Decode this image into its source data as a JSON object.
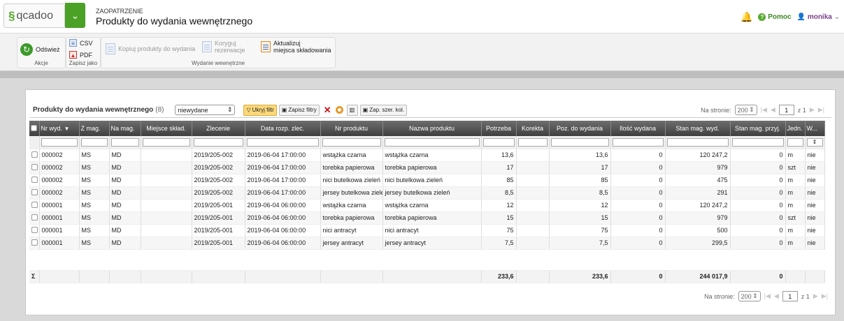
{
  "app": {
    "logo_text": "qcadoo",
    "logo_icon": "qcadoo-swirl-icon"
  },
  "header": {
    "breadcrumb": "ZAOPATRZENIE",
    "title": "Produkty do wydania wewnętrznego",
    "help_label": "Pomoc",
    "user_name": "monika"
  },
  "ribbon": {
    "groups": [
      {
        "label": "Akcje"
      },
      {
        "label": "Zapisz jako"
      },
      {
        "label": "Wydanie wewnętrzne"
      }
    ],
    "refresh_label": "Odśwież",
    "csv_label": "CSV",
    "pdf_label": "PDF",
    "copy_label": "Kopiuj produkty do wydania",
    "correct_label_1": "Koryguj",
    "correct_label_2": "rezerwacje",
    "update_label_1": "Aktualizuj",
    "update_label_2": "miejsca składowania"
  },
  "grid": {
    "title": "Produkty do wydania wewnętrznego",
    "count": "(8)",
    "filter_select": "niewydane",
    "hide_filter": "Ukryj filtr",
    "save_filters": "Zapisz filtry",
    "save_widths": "Zap. szer. kol.",
    "per_page_label": "Na stronie:",
    "per_page_value": "200",
    "page_value": "1",
    "page_of": "z 1",
    "columns": [
      "Nr wyd.",
      "Z mag.",
      "Na mag.",
      "Miejsce skład.",
      "Zlecenie",
      "Data rozp. zlec.",
      "Nr produktu",
      "Nazwa produktu",
      "Potrzeba",
      "Korekta",
      "Poz. do wydania",
      "Ilość wydana",
      "Stan mag. wyd.",
      "Stan mag. przyj.",
      "Jedn.",
      "W..."
    ],
    "rows": [
      [
        "000002",
        "MS",
        "MD",
        "",
        "2019/205-002",
        "2019-06-04 17:00:00",
        "wstążka czarna",
        "wstążka czarna",
        "13,6",
        "",
        "13,6",
        "0",
        "120 247,2",
        "0",
        "m",
        "nie"
      ],
      [
        "000002",
        "MS",
        "MD",
        "",
        "2019/205-002",
        "2019-06-04 17:00:00",
        "torebka papierowa",
        "torebka papierowa",
        "17",
        "",
        "17",
        "0",
        "979",
        "0",
        "szt",
        "nie"
      ],
      [
        "000002",
        "MS",
        "MD",
        "",
        "2019/205-002",
        "2019-06-04 17:00:00",
        "nici butelkowa zieleń",
        "nici butelkowa zieleń",
        "85",
        "",
        "85",
        "0",
        "475",
        "0",
        "m",
        "nie"
      ],
      [
        "000002",
        "MS",
        "MD",
        "",
        "2019/205-002",
        "2019-06-04 17:00:00",
        "jersey butelkowa zieleń",
        "jersey butelkowa zieleń",
        "8,5",
        "",
        "8,5",
        "0",
        "291",
        "0",
        "m",
        "nie"
      ],
      [
        "000001",
        "MS",
        "MD",
        "",
        "2019/205-001",
        "2019-06-04 06:00:00",
        "wstążka czarna",
        "wstążka czarna",
        "12",
        "",
        "12",
        "0",
        "120 247,2",
        "0",
        "m",
        "nie"
      ],
      [
        "000001",
        "MS",
        "MD",
        "",
        "2019/205-001",
        "2019-06-04 06:00:00",
        "torebka papierowa",
        "torebka papierowa",
        "15",
        "",
        "15",
        "0",
        "979",
        "0",
        "szt",
        "nie"
      ],
      [
        "000001",
        "MS",
        "MD",
        "",
        "2019/205-001",
        "2019-06-04 06:00:00",
        "nici antracyt",
        "nici antracyt",
        "75",
        "",
        "75",
        "0",
        "500",
        "0",
        "m",
        "nie"
      ],
      [
        "000001",
        "MS",
        "MD",
        "",
        "2019/205-001",
        "2019-06-04 06:00:00",
        "jersey antracyt",
        "jersey antracyt",
        "7,5",
        "",
        "7,5",
        "0",
        "299,5",
        "0",
        "m",
        "nie"
      ]
    ],
    "sum_symbol": "Σ",
    "sums": {
      "potrzeba": "233,6",
      "poz": "233,6",
      "ilosc": "0",
      "stan_wyd": "244 017,9",
      "stan_przyj": "0"
    }
  }
}
